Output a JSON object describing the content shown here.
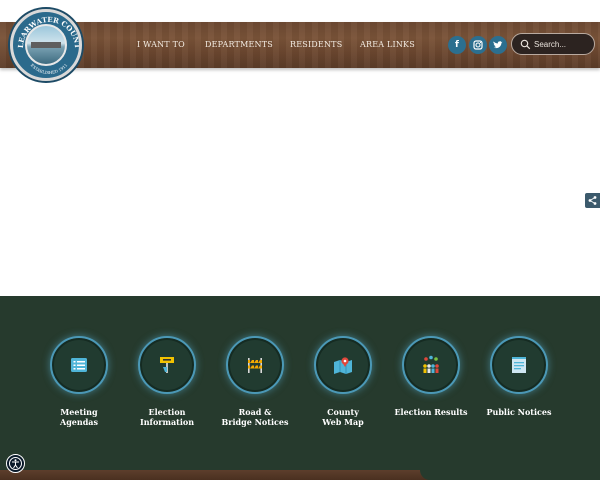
{
  "header": {
    "logo": {
      "name": "Clearwater County seal",
      "ring_text_top": "CLEARWATER COUNTY",
      "ring_text_bottom": "ESTABLISHED 1911"
    },
    "nav": [
      {
        "label": "I WANT TO"
      },
      {
        "label": "DEPARTMENTS"
      },
      {
        "label": "RESIDENTS"
      },
      {
        "label": "AREA LINKS"
      }
    ],
    "social": [
      {
        "glyph": "f",
        "icon": "facebook-icon"
      },
      {
        "glyph": "◎",
        "icon": "instagram-icon"
      },
      {
        "glyph": "🐦",
        "icon": "twitter-icon"
      }
    ],
    "search": {
      "placeholder": "Search..."
    }
  },
  "share": {
    "icon": "share-icon",
    "glyph": "<"
  },
  "quick_links": [
    {
      "label_line1": "Meeting",
      "label_line2": "Agendas",
      "icon": "agenda-list-icon"
    },
    {
      "label_line1": "Election Information",
      "label_line2": "",
      "icon": "vote-sign-icon"
    },
    {
      "label_line1": "Road &",
      "label_line2": "Bridge Notices",
      "icon": "road-barrier-icon"
    },
    {
      "label_line1": "County",
      "label_line2": "Web Map",
      "icon": "map-pin-icon"
    },
    {
      "label_line1": "Election Results",
      "label_line2": "",
      "icon": "people-results-icon"
    },
    {
      "label_line1": "Public Notices",
      "label_line2": "",
      "icon": "notice-paper-icon"
    }
  ],
  "accessibility": {
    "icon": "accessibility-icon"
  },
  "colors": {
    "wood": "#6e4a33",
    "green_section": "#263a2d",
    "circle_ring": "#4b98b6",
    "social": "#2c6f8f"
  }
}
